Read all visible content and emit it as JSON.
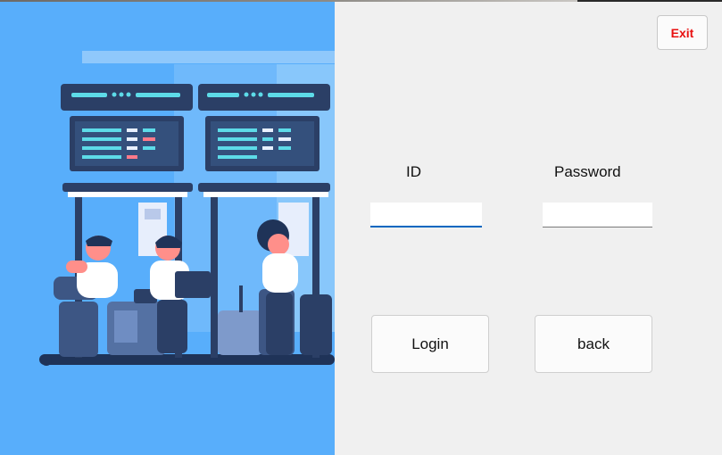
{
  "window": {
    "background_color": "#f0f0f0",
    "illustration_bg_color": "#58aefb"
  },
  "illustration": {
    "name": "airport-check-in-kiosks-illustration"
  },
  "toolbar": {
    "exit_label": "Exit",
    "exit_color": "#e81010"
  },
  "form": {
    "id_label": "ID",
    "password_label": "Password",
    "id_value": "",
    "password_value": "",
    "focused_accent": "#0067c0"
  },
  "actions": {
    "login_label": "Login",
    "back_label": "back"
  }
}
